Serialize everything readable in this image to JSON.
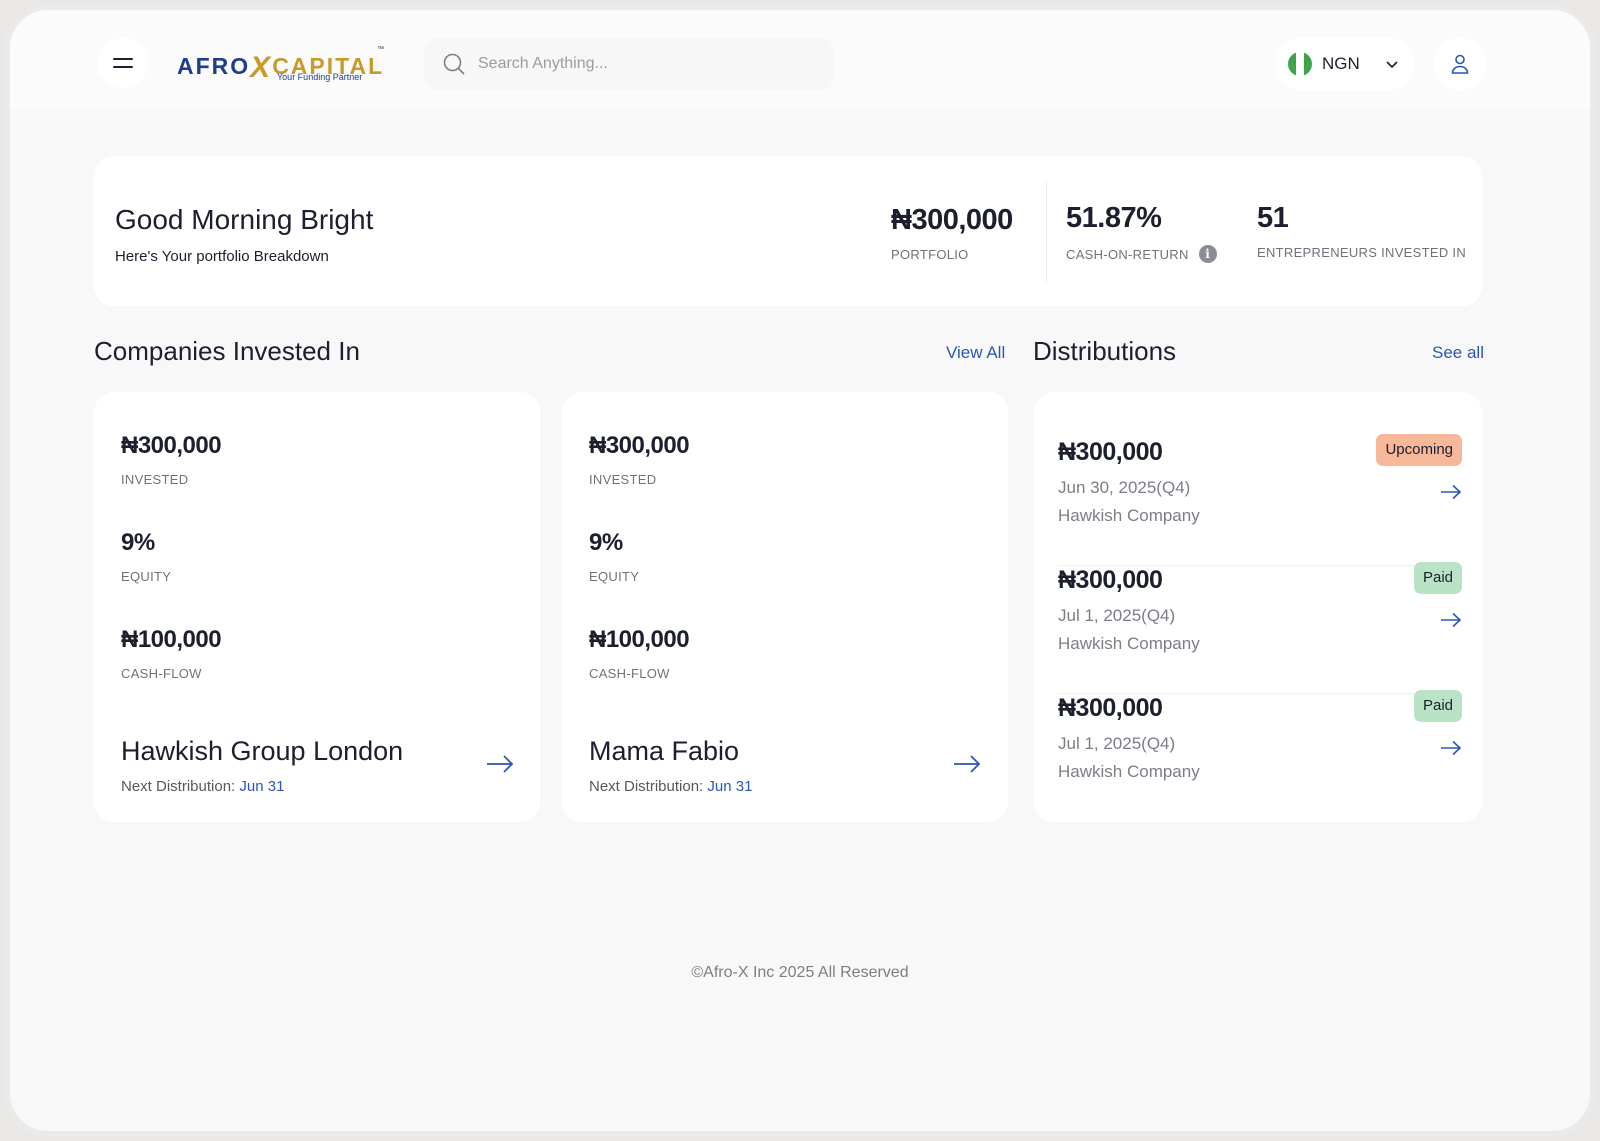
{
  "header": {
    "logo": {
      "afro": "AFRO",
      "x": "X",
      "capital": "CAPITAL",
      "tm": "™",
      "tagline": "Your Funding Partner"
    },
    "search": {
      "placeholder": "Search Anything..."
    },
    "currency": {
      "code": "NGN",
      "flag": "nigeria-flag"
    }
  },
  "summary": {
    "greeting": "Good Morning Bright",
    "subtitle": "Here's Your portfolio Breakdown",
    "stats": [
      {
        "value": "₦300,000",
        "label": "PORTFOLIO"
      },
      {
        "value": "51.87%",
        "label": "CASH-ON-RETURN"
      },
      {
        "value": "51",
        "label": "ENTREPRENEURS INVESTED IN"
      }
    ]
  },
  "companies": {
    "title": "Companies Invested In",
    "view_all": "View All",
    "next_distribution_label": "Next Distribution: ",
    "items": [
      {
        "invested": "₦300,000",
        "invested_label": "INVESTED",
        "equity": "9%",
        "equity_label": "EQUITY",
        "cash_flow": "₦100,000",
        "cash_flow_label": "CASH-FLOW",
        "name": "Hawkish Group London",
        "next_distribution": "Jun 31"
      },
      {
        "invested": "₦300,000",
        "invested_label": "INVESTED",
        "equity": "9%",
        "equity_label": "EQUITY",
        "cash_flow": "₦100,000",
        "cash_flow_label": "CASH-FLOW",
        "name": "Mama Fabio",
        "next_distribution": "Jun 31"
      }
    ]
  },
  "distributions": {
    "title": "Distributions",
    "see_all": "See all",
    "items": [
      {
        "amount": "₦300,000",
        "date": "Jun 30, 2025(Q4)",
        "company": "Hawkish Company",
        "status": "Upcoming",
        "status_color": "#f7b799"
      },
      {
        "amount": "₦300,000",
        "date": "Jul 1, 2025(Q4)",
        "company": "Hawkish Company",
        "status": "Paid",
        "status_color": "#b9e3c4"
      },
      {
        "amount": "₦300,000",
        "date": "Jul 1, 2025(Q4)",
        "company": "Hawkish Company",
        "status": "Paid",
        "status_color": "#b9e3c4"
      }
    ]
  },
  "footer": {
    "copyright": "©Afro-X Inc 2025 All Reserved"
  },
  "colors": {
    "accent": "#2d55b8",
    "brand_blue": "#1f3d8f",
    "brand_gold": "#c79a2a"
  }
}
